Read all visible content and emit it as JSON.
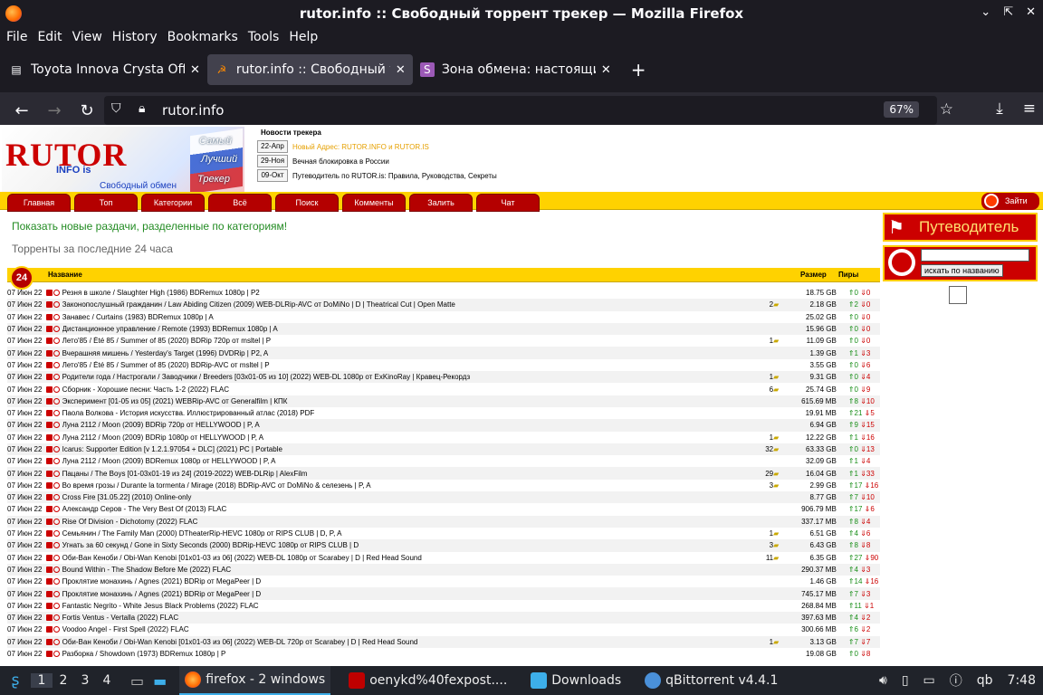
{
  "window": {
    "title": "rutor.info :: Свободный торрент трекер — Mozilla Firefox"
  },
  "menu": [
    "File",
    "Edit",
    "View",
    "History",
    "Bookmarks",
    "Tools",
    "Help"
  ],
  "tabs": [
    {
      "label": "Toyota Innova Crysta Offi",
      "active": false
    },
    {
      "label": "rutor.info :: Свободный т",
      "active": true
    },
    {
      "label": "Зона обмена: настоящи",
      "active": false
    }
  ],
  "nav": {
    "url": "rutor.info",
    "zoom": "67%"
  },
  "logo": {
    "title": "RUTOR",
    "info": "INFO is",
    "tagline": "Свободный обмен",
    "words": [
      "Самый",
      "Лучший",
      "Трекер"
    ]
  },
  "news": {
    "heading": "Новости трекера",
    "items": [
      {
        "date": "22-Апр",
        "text": "Новый Адрес: RUTOR.INFO и RUTOR.IS"
      },
      {
        "date": "29-Ноя",
        "text": "Вечная блокировка в России"
      },
      {
        "date": "09-Окт",
        "text": "Путеводитель по RUTOR.is: Правила, Руководства, Секреты"
      }
    ]
  },
  "site_menu": [
    "Главная",
    "Топ",
    "Категории",
    "Всё",
    "Поиск",
    "Комменты",
    "Залить",
    "Чат"
  ],
  "login": "Зайти",
  "new_link": "Показать новые раздачи, разделенные по категориям!",
  "period": "Торренты за последние 24 часа",
  "guide": "Путеводитель",
  "search_button": "искать по названию",
  "table": {
    "badge": "24",
    "headers": {
      "name": "Название",
      "size": "Размер",
      "peers": "Пиры"
    },
    "rows": [
      {
        "date": "07 Июн 22",
        "name": "Резня в школе / Slaughter High (1986) BDRemux 1080p | P2",
        "comments": "",
        "size": "18.75 GB",
        "seeds": "0",
        "leech": "0"
      },
      {
        "date": "07 Июн 22",
        "name": "Законопослушный гражданин / Law Abiding Citizen (2009) WEB-DLRip-AVC от DoMiNo | D | Theatrical Cut | Open Matte",
        "comments": "2",
        "size": "2.18 GB",
        "seeds": "2",
        "leech": "0"
      },
      {
        "date": "07 Июн 22",
        "name": "Занавес / Curtains (1983) BDRemux 1080p | A",
        "comments": "",
        "size": "25.02 GB",
        "seeds": "0",
        "leech": "0"
      },
      {
        "date": "07 Июн 22",
        "name": "Дистанционное управление / Remote (1993) BDRemux 1080p | A",
        "comments": "",
        "size": "15.96 GB",
        "seeds": "0",
        "leech": "0"
      },
      {
        "date": "07 Июн 22",
        "name": "Лето'85 / Été 85 / Summer of 85 (2020) BDRip 720p от msltel | P",
        "comments": "1",
        "size": "11.09 GB",
        "seeds": "0",
        "leech": "0"
      },
      {
        "date": "07 Июн 22",
        "name": "Вчерашняя мишень / Yesterday's Target (1996) DVDRip | P2, A",
        "comments": "",
        "size": "1.39 GB",
        "seeds": "1",
        "leech": "3"
      },
      {
        "date": "07 Июн 22",
        "name": "Лето'85 / Été 85 / Summer of 85 (2020) BDRip-AVC от msltel | P",
        "comments": "",
        "size": "3.55 GB",
        "seeds": "0",
        "leech": "6"
      },
      {
        "date": "07 Июн 22",
        "name": "Родители года / Настрогали / Заводчики / Breeders [03x01-05 из 10] (2022) WEB-DL 1080p от ExKinoRay | Кравец-Рекордз",
        "comments": "1",
        "size": "9.31 GB",
        "seeds": "0",
        "leech": "4"
      },
      {
        "date": "07 Июн 22",
        "name": "Сборник - Хорошие песни: Часть 1-2 (2022) FLAC",
        "comments": "6",
        "size": "25.74 GB",
        "seeds": "0",
        "leech": "9"
      },
      {
        "date": "07 Июн 22",
        "name": "Эксперимент [01-05 из 05] (2021) WEBRip-AVC от Generalfilm | КПК",
        "comments": "",
        "size": "615.69 MB",
        "seeds": "8",
        "leech": "10"
      },
      {
        "date": "07 Июн 22",
        "name": "Паола Волкова - История искусства. Иллюстрированный атлас (2018) PDF",
        "comments": "",
        "size": "19.91 MB",
        "seeds": "21",
        "leech": "5"
      },
      {
        "date": "07 Июн 22",
        "name": "Луна 2112 / Moon (2009) BDRip 720p от HELLYWOOD | P, A",
        "comments": "",
        "size": "6.94 GB",
        "seeds": "9",
        "leech": "15"
      },
      {
        "date": "07 Июн 22",
        "name": "Луна 2112 / Moon (2009) BDRip 1080p от HELLYWOOD | P, A",
        "comments": "1",
        "size": "12.22 GB",
        "seeds": "1",
        "leech": "16"
      },
      {
        "date": "07 Июн 22",
        "name": "Icarus: Supporter Edition [v 1.2.1.97054 + DLC] (2021) PC | Portable",
        "comments": "32",
        "size": "63.33 GB",
        "seeds": "0",
        "leech": "13"
      },
      {
        "date": "07 Июн 22",
        "name": "Луна 2112 / Moon (2009) BDRemux 1080p от HELLYWOOD | P, A",
        "comments": "",
        "size": "32.09 GB",
        "seeds": "1",
        "leech": "4"
      },
      {
        "date": "07 Июн 22",
        "name": "Пацаны / The Boys [01-03x01-19 из 24] (2019-2022) WEB-DLRip | AlexFilm",
        "comments": "29",
        "size": "16.04 GB",
        "seeds": "1",
        "leech": "33"
      },
      {
        "date": "07 Июн 22",
        "name": "Во время грозы / Durante la tormenta / Mirage (2018) BDRip-AVC от DoMiNo & селезень | P, A",
        "comments": "3",
        "size": "2.99 GB",
        "seeds": "17",
        "leech": "16"
      },
      {
        "date": "07 Июн 22",
        "name": "Cross Fire [31.05.22] (2010) Online-only",
        "comments": "",
        "size": "8.77 GB",
        "seeds": "7",
        "leech": "10"
      },
      {
        "date": "07 Июн 22",
        "name": "Александр Серов - The Very Best Of (2013) FLAC",
        "comments": "",
        "size": "906.79 MB",
        "seeds": "17",
        "leech": "6"
      },
      {
        "date": "07 Июн 22",
        "name": "Rise Of Division - Dichotomy (2022) FLAC",
        "comments": "",
        "size": "337.17 MB",
        "seeds": "8",
        "leech": "4"
      },
      {
        "date": "07 Июн 22",
        "name": "Семьянин / The Family Man (2000) DTheaterRip-HEVC 1080p от RIPS CLUB | D, P, A",
        "comments": "1",
        "size": "6.51 GB",
        "seeds": "4",
        "leech": "6"
      },
      {
        "date": "07 Июн 22",
        "name": "Угнать за 60 секунд / Gone in Sixty Seconds (2000) BDRip-HEVC 1080p от RIPS CLUB | D",
        "comments": "3",
        "size": "6.43 GB",
        "seeds": "8",
        "leech": "8"
      },
      {
        "date": "07 Июн 22",
        "name": "Оби-Ван Кеноби / Obi-Wan Kenobi [01x01-03 из 06] (2022) WEB-DL 1080p от Scarabey | D | Red Head Sound",
        "comments": "11",
        "size": "6.35 GB",
        "seeds": "27",
        "leech": "90"
      },
      {
        "date": "07 Июн 22",
        "name": "Bound Within - The Shadow Before Me (2022) FLAC",
        "comments": "",
        "size": "290.37 MB",
        "seeds": "4",
        "leech": "3"
      },
      {
        "date": "07 Июн 22",
        "name": "Проклятие монахинь / Agnes (2021) BDRip от MegaPeer | D",
        "comments": "",
        "size": "1.46 GB",
        "seeds": "14",
        "leech": "16"
      },
      {
        "date": "07 Июн 22",
        "name": "Проклятие монахинь / Agnes (2021) BDRip от MegaPeer | D",
        "comments": "",
        "size": "745.17 MB",
        "seeds": "7",
        "leech": "3"
      },
      {
        "date": "07 Июн 22",
        "name": "Fantastic Negrito - White Jesus Black Problems (2022) FLAC",
        "comments": "",
        "size": "268.84 MB",
        "seeds": "11",
        "leech": "1"
      },
      {
        "date": "07 Июн 22",
        "name": "Fortis Ventus - Vertalla (2022) FLAC",
        "comments": "",
        "size": "397.63 MB",
        "seeds": "4",
        "leech": "2"
      },
      {
        "date": "07 Июн 22",
        "name": "Voodoo Angel - First Spell (2022) FLAC",
        "comments": "",
        "size": "300.66 MB",
        "seeds": "6",
        "leech": "2"
      },
      {
        "date": "07 Июн 22",
        "name": "Оби-Ван Кеноби / Obi-Wan Kenobi [01x01-03 из 06] (2022) WEB-DL 720p от Scarabey | D | Red Head Sound",
        "comments": "1",
        "size": "3.13 GB",
        "seeds": "7",
        "leech": "7"
      },
      {
        "date": "07 Июн 22",
        "name": "Разборка / Showdown (1973) BDRemux 1080p | P",
        "comments": "",
        "size": "19.08 GB",
        "seeds": "0",
        "leech": "8"
      }
    ]
  },
  "taskbar": {
    "workspaces": [
      "1",
      "2",
      "3",
      "4"
    ],
    "apps": [
      {
        "label": "firefox - 2 windows",
        "active": true
      },
      {
        "label": "oenykd%40fexpost....",
        "active": false
      },
      {
        "label": "Downloads",
        "active": false
      },
      {
        "label": "qBittorrent v4.4.1",
        "active": false
      }
    ],
    "clock": "7:48"
  }
}
